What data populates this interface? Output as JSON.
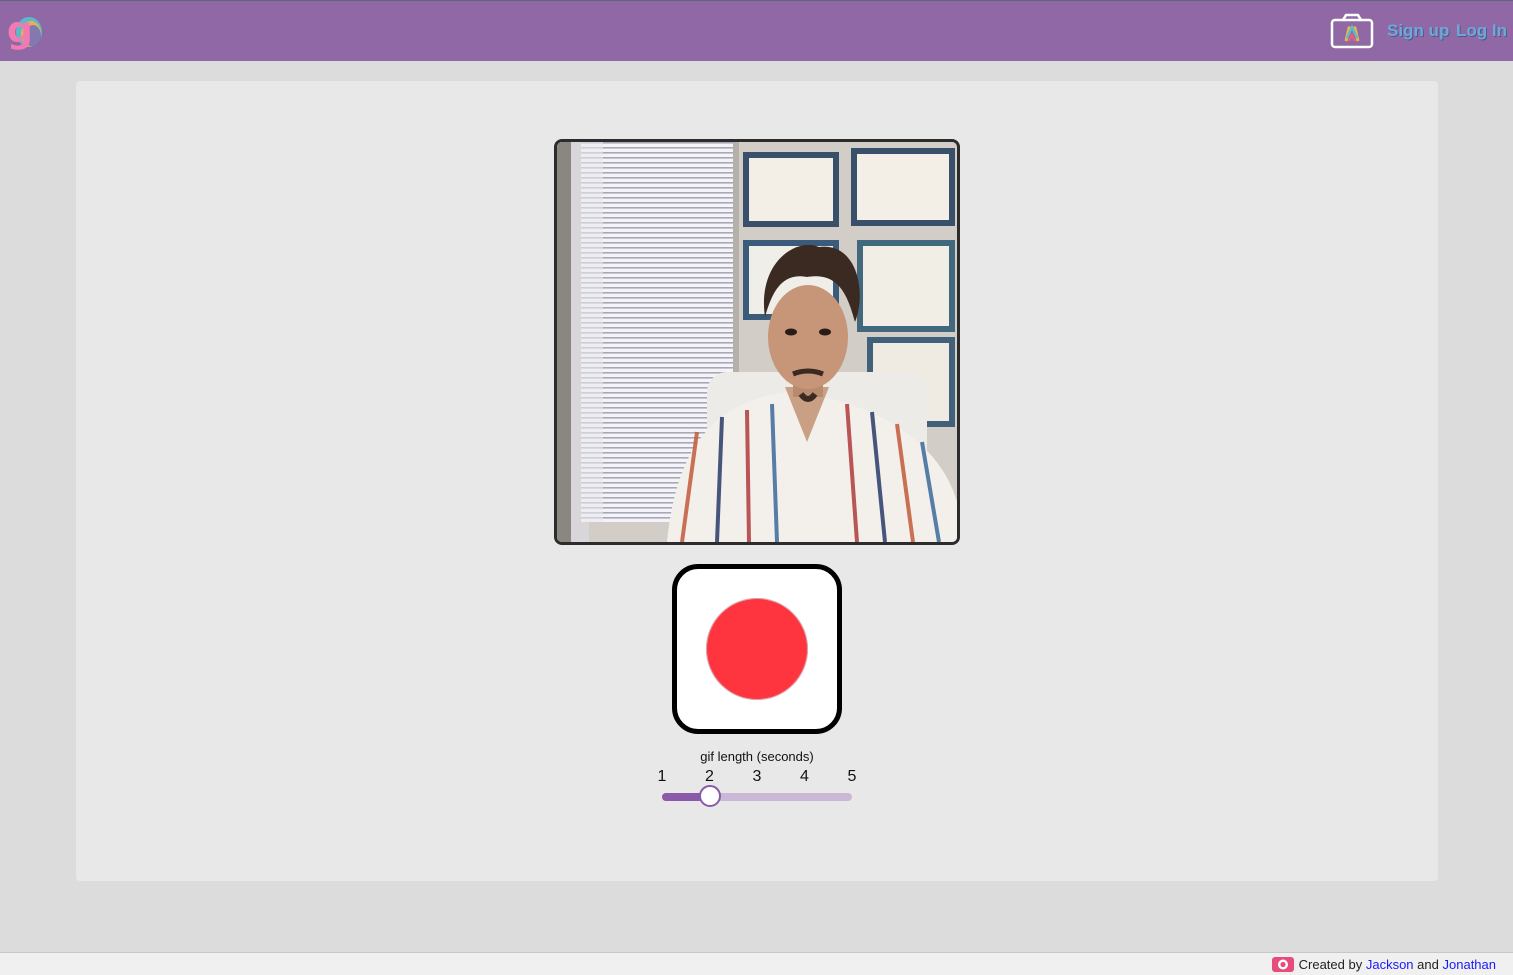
{
  "header": {
    "logo_icon": "gif-logo-icon",
    "camera_icon": "camera-icon",
    "signup_label": "Sign up",
    "login_label": "Log In",
    "background_color": "#9068a6"
  },
  "main": {
    "video_preview": "webcam-preview",
    "record_button_color": "#fe343e",
    "slider": {
      "label": "gif length (seconds)",
      "ticks": [
        "1",
        "2",
        "3",
        "4",
        "5"
      ],
      "min": 1,
      "max": 5,
      "value": 2
    }
  },
  "footer": {
    "icon": "github-icon",
    "prefix": "Created by",
    "author1": "Jackson",
    "conjunction": "and",
    "author2": "Jonathan"
  }
}
